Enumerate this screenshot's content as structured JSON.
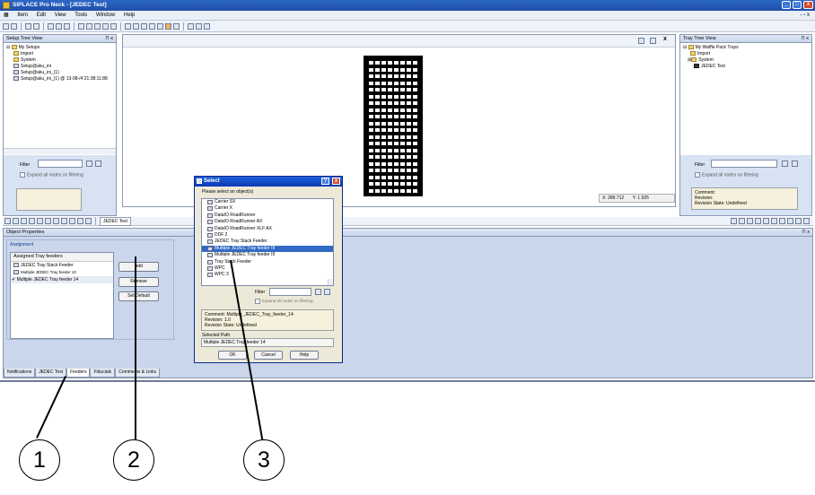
{
  "window": {
    "title": "SIPLACE Pro Neck - [JEDEC Test]"
  },
  "menu": [
    "Item",
    "Edit",
    "View",
    "Tools",
    "Window",
    "Help"
  ],
  "setup_tree": {
    "title": "Setup Tree View",
    "items": [
      "My Setups",
      "Import",
      "System",
      "Setup@aku_ini",
      "Setup@aku_ini_(1)",
      "Setup@aku_ini_(1) @ 13-08-/4 21:38:11:88"
    ],
    "filter_label": "Filter",
    "expand_label": "Expand all nodes on filtering"
  },
  "tray_tree": {
    "title": "Tray Tree View",
    "items": [
      "My Waffle Pack Trays",
      "Import",
      "System",
      "JEDEC Test"
    ],
    "filter_label": "Filter",
    "expand_label": "Expand all nodes on filtering",
    "comment": "Comment:",
    "revision": "Revision:",
    "revision_state": "Revision State: Undefined"
  },
  "coords": {
    "x": "X: 289.712",
    "y": "Y: 1.925"
  },
  "doc_tab": "JEDEC Test",
  "object_properties": {
    "title": "Object Properties",
    "section": "Assignment",
    "list_header": "Assigned Tray feeders",
    "items": [
      "JEDEC Tray Stack Feeder",
      "Multiple JEDEC Tray feeder 10",
      "Multiple JEDEC Tray feeder 14"
    ],
    "btn_add": "Add",
    "btn_remove": "Remove",
    "btn_default": "Set Default"
  },
  "bottom_tabs": [
    "Notifications",
    "JEDEC Test",
    "Feeders",
    "Fiducials",
    "Comments & Links"
  ],
  "dialog": {
    "title": "Select",
    "prompt": "Please select an object(s)",
    "items": [
      "Carrier SX",
      "Carrier X",
      "DataIO RoadRunner",
      "DataIO RoadRunner AX",
      "DataIO RoadRunner XLF AX",
      "DDF 2",
      "JEDEC Tray Stack Feeder",
      "Multiple JEDEC Tray feeder III",
      "Multiple JEDEC Tray feeder III",
      "Tray Stack Feeder",
      "WPC",
      "WPC 3"
    ],
    "selected_index": 7,
    "filter_label": "Filter",
    "expand_label": "Expand all nodes on filtering",
    "comment": "Comment: Multiple_JEDEC_Tray_feeder_14",
    "revision": "Revision: 1.0",
    "revision_state": "Revision State: Undefined",
    "selected_path_label": "Selected Path",
    "selected_path": "Multiple JEDEC Tray feeder 14",
    "ok": "OK",
    "cancel": "Cancel",
    "help": "Help"
  },
  "callouts": [
    "1",
    "2",
    "3"
  ]
}
